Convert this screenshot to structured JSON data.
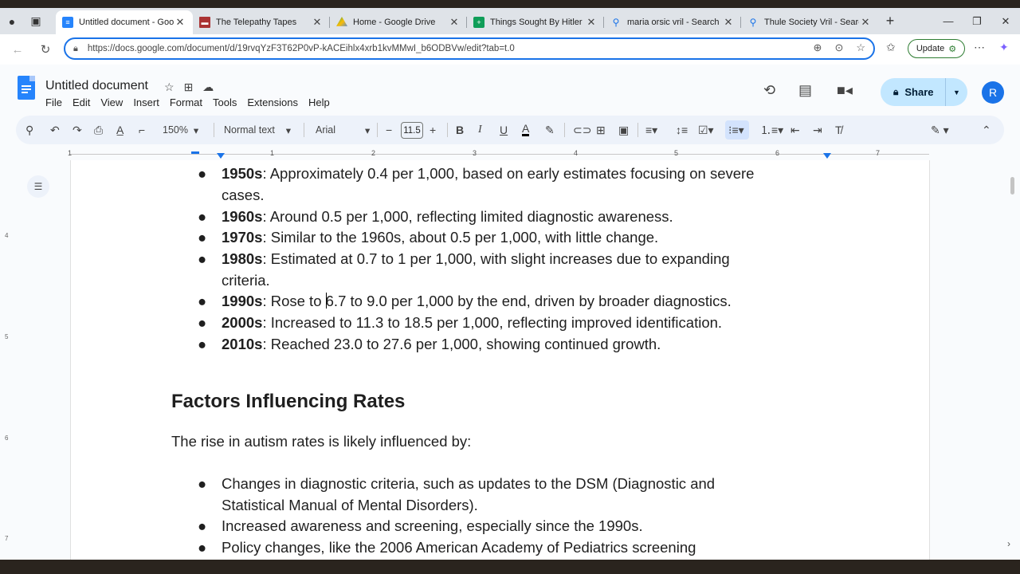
{
  "tabs": [
    {
      "title": "Untitled document - Google Docs",
      "icon": "docs-icon",
      "color": "#2684fc",
      "active": true
    },
    {
      "title": "The Telepathy Tapes",
      "icon": "telepathy-icon",
      "color": "#a33",
      "active": false
    },
    {
      "title": "Home - Google Drive",
      "icon": "drive-icon",
      "color": "#34a853",
      "active": false
    },
    {
      "title": "Things Sought By Hitler - Google Sheets",
      "icon": "sheets-icon",
      "color": "#0f9d58",
      "active": false
    },
    {
      "title": "maria orsic vril - Search",
      "icon": "search-icon",
      "color": "#1a73e8",
      "active": false
    },
    {
      "title": "Thule Society Vril - Search Images",
      "icon": "search-icon",
      "color": "#1a73e8",
      "active": false
    }
  ],
  "address": {
    "url": "https://docs.google.com/document/d/19rvqYzF3T62P0vP-kACEihlx4xrb1kvMMwI_b6ODBVw/edit?tab=t.0",
    "update_label": "Update"
  },
  "doc": {
    "title": "Untitled document",
    "menus": [
      "File",
      "Edit",
      "View",
      "Insert",
      "Format",
      "Tools",
      "Extensions",
      "Help"
    ],
    "share_label": "Share",
    "avatar_letter": "R"
  },
  "toolbar": {
    "zoom": "150%",
    "style": "Normal text",
    "font": "Arial",
    "font_size": "11.5"
  },
  "ruler": [
    "1",
    "1",
    "2",
    "3",
    "4",
    "5",
    "6",
    "7"
  ],
  "vruler": [
    "4",
    "5",
    "6",
    "7"
  ],
  "content": {
    "decades": [
      {
        "label": "1950s",
        "text": ": Approximately 0.4 per 1,000, based on early estimates focusing on severe",
        "cont": "cases."
      },
      {
        "label": "1960s",
        "text": ": Around 0.5 per 1,000, reflecting limited diagnostic awareness.",
        "cont": ""
      },
      {
        "label": "1970s",
        "text": ": Similar to the 1960s, about 0.5 per 1,000, with little change.",
        "cont": ""
      },
      {
        "label": "1980s",
        "text": ": Estimated at 0.7 to 1 per 1,000, with slight increases due to expanding",
        "cont": "criteria."
      },
      {
        "label": "1990s",
        "text_before": ": Rose to ",
        "text_after": "6.7 to 9.0 per 1,000 by the end, driven by broader diagnostics."
      },
      {
        "label": "2000s",
        "text": ": Increased to 11.3 to 18.5 per 1,000, reflecting improved identification.",
        "cont": ""
      },
      {
        "label": "2010s",
        "text": ": Reached 23.0 to 27.6 per 1,000, showing continued growth.",
        "cont": ""
      }
    ],
    "heading": "Factors Influencing Rates",
    "intro": "The rise in autism rates is likely influenced by:",
    "factors": [
      {
        "line1": "Changes in diagnostic criteria, such as updates to the DSM (Diagnostic and",
        "line2": "Statistical Manual of Mental Disorders)."
      },
      {
        "line1": "Increased awareness and screening, especially since the 1990s.",
        "line2": ""
      },
      {
        "line1": "Policy changes, like the 2006 American Academy of Pediatrics screening",
        "line2": ""
      }
    ]
  }
}
